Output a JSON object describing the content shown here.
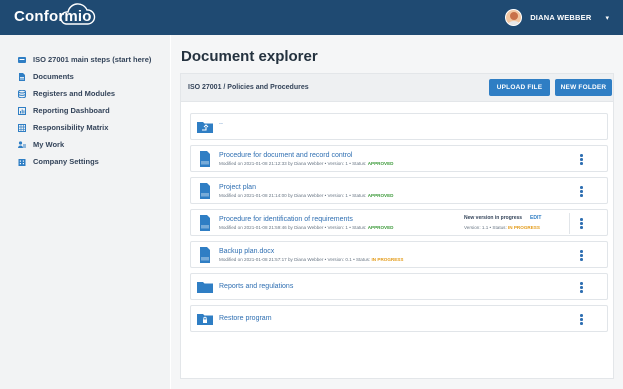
{
  "app": {
    "logo": "Conformio"
  },
  "user": {
    "name": "DIANA WEBBER",
    "menu_caret": "▾"
  },
  "sidebar": {
    "items": [
      {
        "label": "ISO 27001 main steps (start here)",
        "icon": "steps-icon"
      },
      {
        "label": "Documents",
        "icon": "document-icon"
      },
      {
        "label": "Registers and Modules",
        "icon": "registers-icon"
      },
      {
        "label": "Reporting Dashboard",
        "icon": "dashboard-icon"
      },
      {
        "label": "Responsibility Matrix",
        "icon": "matrix-icon"
      },
      {
        "label": "My Work",
        "icon": "my-work-icon"
      },
      {
        "label": "Company Settings",
        "icon": "company-icon"
      }
    ]
  },
  "main": {
    "title": "Document explorer",
    "breadcrumb": "ISO 27001 /  Policies and Procedures",
    "upload_label": "UPLOAD FILE",
    "new_folder_label": "NEW FOLDER",
    "parent_label": "..",
    "files": [
      {
        "title": "Procedure for document and record control",
        "meta_prefix": "Modified on 2021-01-08 21:12:33 by Diana Webber  •  Version: 1  •  Status: ",
        "status": "APPROVED"
      },
      {
        "title": "Project plan",
        "meta_prefix": "Modified on 2021-01-08 21:14:00 by Diana Webber  •  Version: 1  •  Status: ",
        "status": "APPROVED"
      },
      {
        "title": "Procedure for identification of requirements",
        "meta_prefix": "Modified on 2021-01-08 21:59:46 by Diana Webber  •  Version: 1  •  Status: ",
        "status": "APPROVED",
        "new_version": {
          "label": "New version in progress",
          "edit_label": "EDIT",
          "meta_prefix": "Version: 1.1  •  Status: ",
          "status": "IN PROGRESS"
        }
      },
      {
        "title": "Backup plan.docx",
        "meta_prefix": "Modified on 2021-01-08 21:57:17 by Diana Webber  •  Version: 0.1  •  Status: ",
        "status": "IN PROGRESS"
      }
    ],
    "folders": [
      {
        "title": "Reports and regulations",
        "icon": "folder-icon"
      },
      {
        "title": "Restore program",
        "icon": "locked-folder-icon"
      }
    ]
  },
  "colors": {
    "topbar": "#1f4a72",
    "accent": "#2f7ec4",
    "approved": "#3c9a3a",
    "in_progress": "#e39b18"
  }
}
